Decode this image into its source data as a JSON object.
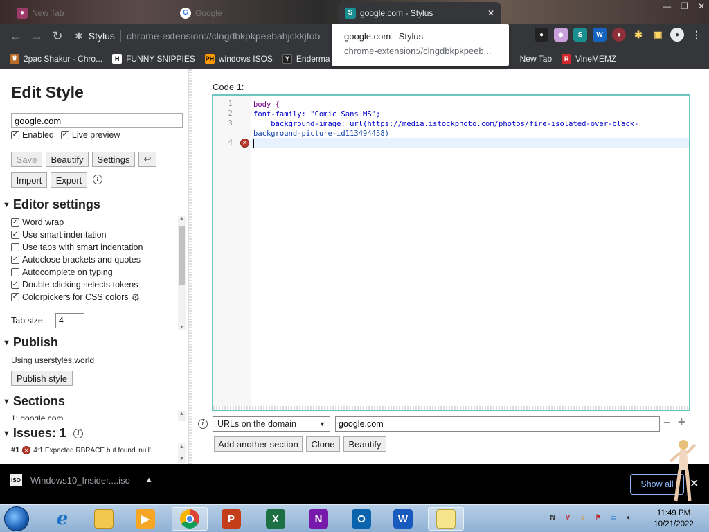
{
  "browser": {
    "tabs": [
      {
        "title": "New Tab"
      },
      {
        "title": "Google"
      },
      {
        "title": "google.com - Stylus"
      }
    ],
    "omnibox": {
      "site": "Stylus",
      "url": "chrome-extension://clngdbkpkpeebahjckkjfob"
    },
    "tooltip": {
      "title": "google.com - Stylus",
      "url": "chrome-extension://clngdbkpkpeeb..."
    },
    "bookmarks": [
      {
        "label": "2pac Shakur - Chro..."
      },
      {
        "label": "FUNNY SNIPPIES"
      },
      {
        "label": "windows ISOS"
      },
      {
        "label": "Enderma"
      },
      {
        "label": "New Tab"
      },
      {
        "label": "VineMEMZ"
      }
    ]
  },
  "sidebar": {
    "title": "Edit Style",
    "style_name": "google.com",
    "enabled_label": "Enabled",
    "live_preview_label": "Live preview",
    "buttons": {
      "save": "Save",
      "beautify": "Beautify",
      "settings": "Settings",
      "undo_icon": "↩",
      "import": "Import",
      "export": "Export"
    },
    "editor_settings": {
      "heading": "Editor settings",
      "options": [
        {
          "label": "Word wrap",
          "checked": true
        },
        {
          "label": "Use smart indentation",
          "checked": true
        },
        {
          "label": "Use tabs with smart indentation",
          "checked": false
        },
        {
          "label": "Autoclose brackets and quotes",
          "checked": true
        },
        {
          "label": "Autocomplete on typing",
          "checked": false
        },
        {
          "label": "Double-clicking selects tokens",
          "checked": true
        },
        {
          "label": "Colorpickers for CSS colors",
          "checked": true
        }
      ],
      "tab_size_label": "Tab size",
      "tab_size_value": "4"
    },
    "publish": {
      "heading": "Publish",
      "link": "Using userstyles.world",
      "button": "Publish style"
    },
    "sections": {
      "heading": "Sections",
      "item": "1: google.com"
    },
    "issues": {
      "heading": "Issues: 1",
      "number": "#1",
      "text": "4:1 Expected RBRACE but found 'null'."
    }
  },
  "editor": {
    "label": "Code 1:",
    "lines": [
      {
        "num": "1",
        "text": "body {"
      },
      {
        "num": "2",
        "text": "font-family: \"Comic Sans MS\";"
      },
      {
        "num": "3",
        "text": "    background-image: url(https://media.istockphoto.com/photos/fire-isolated-over-black-"
      },
      {
        "num": "",
        "text": "background-picture-id113494458)"
      },
      {
        "num": "4",
        "text": ""
      }
    ],
    "applies_to_type": "URLs on the domain",
    "applies_to_value": "google.com",
    "add_section": "Add another section",
    "clone": "Clone",
    "beautify": "Beautify"
  },
  "downloads": {
    "file": "Windows10_Insider....iso",
    "show_all": "Show all"
  },
  "taskbar": {
    "time": "11:49 PM",
    "date": "10/21/2022"
  },
  "colors": {
    "accent_border": "#6cc7c0",
    "error": "#c0392b",
    "chrome_dark": "#35363a"
  }
}
